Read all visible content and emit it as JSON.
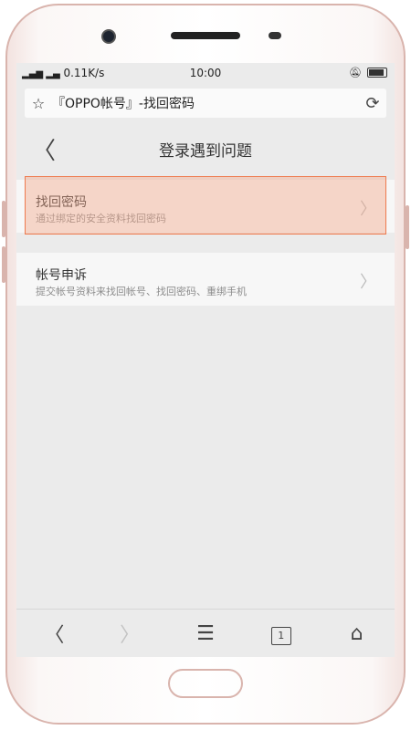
{
  "status_bar": {
    "signal": "𝄖𝄖",
    "speed": "0.11K/s",
    "time": "10:00",
    "mute_icon": "bell-off-icon",
    "battery_icon": "battery-icon"
  },
  "url_bar": {
    "star_icon": "☆",
    "text": "『OPPO帐号』-找回密码",
    "reload_icon": "⟳"
  },
  "header": {
    "back_icon": "〈",
    "title": "登录遇到问题"
  },
  "items": [
    {
      "label": "找回密码",
      "desc": "通过绑定的安全资料找回密码",
      "chevron": "〉"
    },
    {
      "label": "帐号申诉",
      "desc": "提交帐号资料来找回帐号、找回密码、重绑手机",
      "chevron": "〉"
    }
  ],
  "nav": {
    "back": "〈",
    "forward": "〉",
    "menu": "☰",
    "tabs_count": "1",
    "home": "⌂"
  },
  "colors": {
    "highlight": "#ee7a4e",
    "screen_bg": "#ebebeb",
    "phone_trim": "#d9b4ad"
  }
}
